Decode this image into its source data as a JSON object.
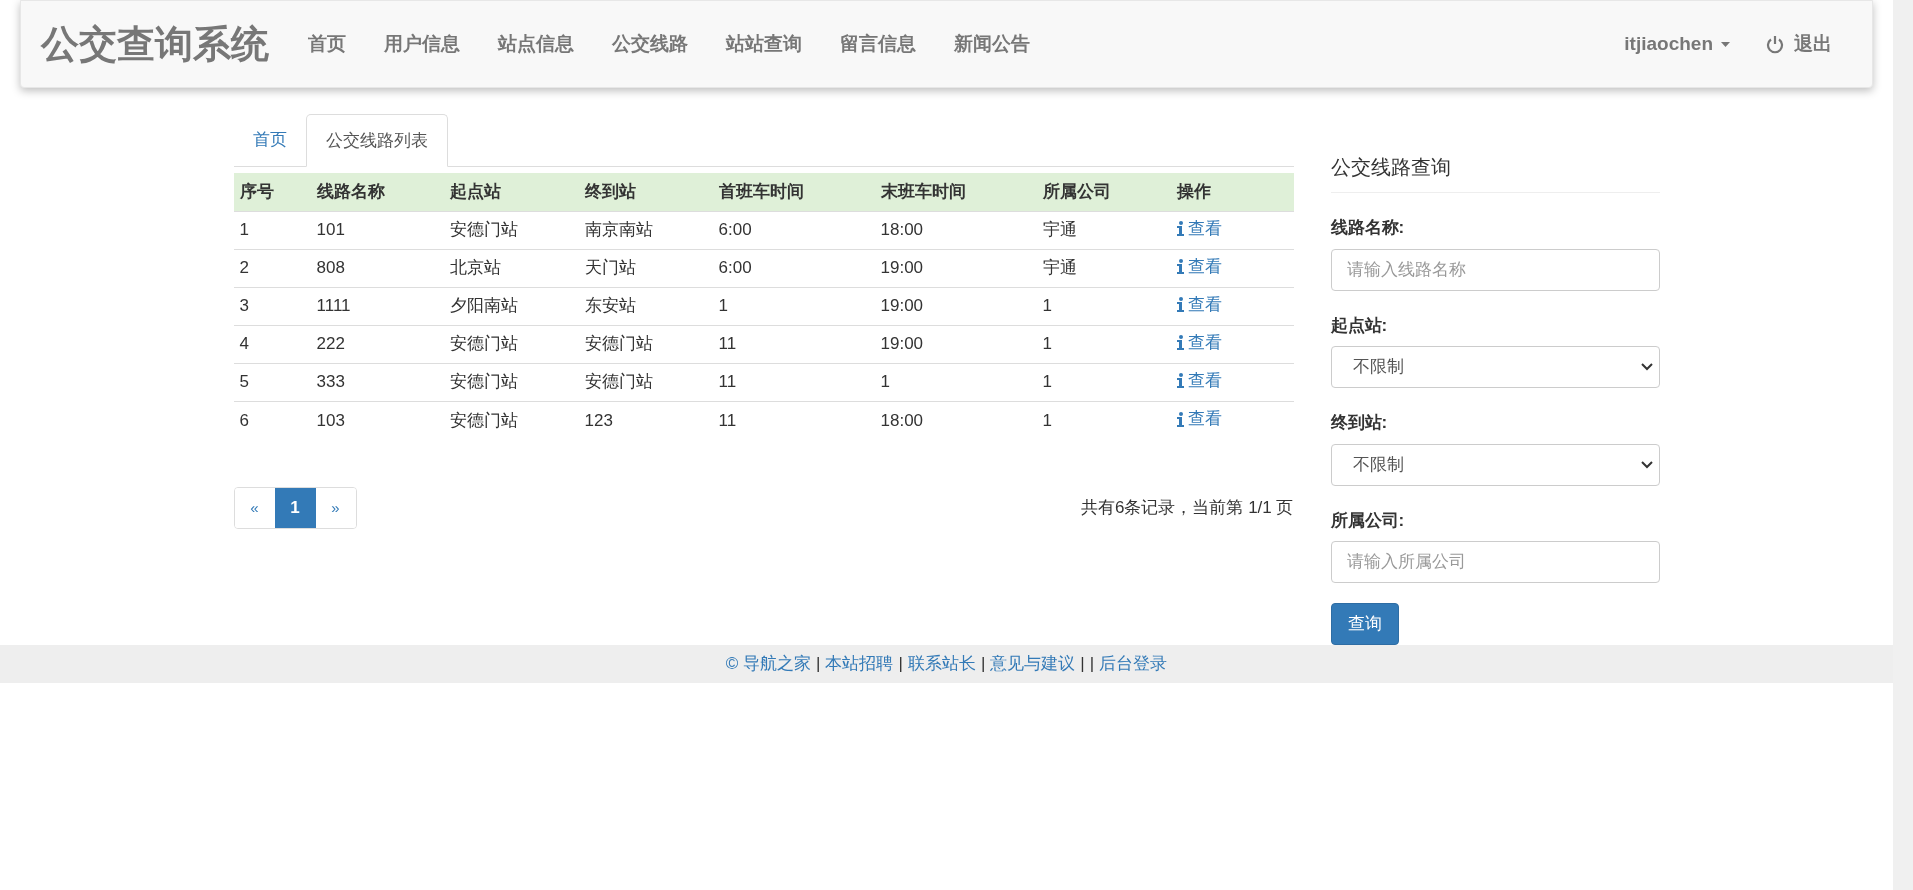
{
  "navbar": {
    "brand": "公交查询系统",
    "items": [
      "首页",
      "用户信息",
      "站点信息",
      "公交线路",
      "站站查询",
      "留言信息",
      "新闻公告"
    ],
    "user": "itjiaochen",
    "logout": "退出"
  },
  "tabs": [
    {
      "label": "首页",
      "selected": false
    },
    {
      "label": "公交线路列表",
      "selected": true
    }
  ],
  "table": {
    "columns": [
      "序号",
      "线路名称",
      "起点站",
      "终到站",
      "首班车时间",
      "末班车时间",
      "所属公司",
      "操作"
    ],
    "rows": [
      {
        "cells": [
          "1",
          "101",
          "安德门站",
          "南京南站",
          "6:00",
          "18:00",
          "宇通"
        ],
        "action": "查看"
      },
      {
        "cells": [
          "2",
          "808",
          "北京站",
          "天门站",
          "6:00",
          "19:00",
          "宇通"
        ],
        "action": "查看"
      },
      {
        "cells": [
          "3",
          "1111",
          "夕阳南站",
          "东安站",
          "1",
          "19:00",
          "1"
        ],
        "action": "查看"
      },
      {
        "cells": [
          "4",
          "222",
          "安德门站",
          "安德门站",
          "11",
          "19:00",
          "1"
        ],
        "action": "查看"
      },
      {
        "cells": [
          "5",
          "333",
          "安德门站",
          "安德门站",
          "11",
          "1",
          "1"
        ],
        "action": "查看"
      },
      {
        "cells": [
          "6",
          "103",
          "安德门站",
          "123",
          "11",
          "18:00",
          "1"
        ],
        "action": "查看"
      }
    ]
  },
  "pagination": {
    "pages": [
      {
        "label": "«",
        "selected": false
      },
      {
        "label": "1",
        "selected": true
      },
      {
        "label": "»",
        "selected": false
      }
    ],
    "summary": "共有6条记录，当前第 1/1 页"
  },
  "search_panel": {
    "title": "公交线路查询",
    "fields": [
      {
        "kind": "input",
        "label": "线路名称:",
        "placeholder": "请输入线路名称"
      },
      {
        "kind": "select",
        "label": "起点站:",
        "value": "不限制"
      },
      {
        "kind": "select",
        "label": "终到站:",
        "value": "不限制"
      },
      {
        "kind": "input",
        "label": "所属公司:",
        "placeholder": "请输入所属公司"
      }
    ],
    "button": "查询"
  },
  "footer": {
    "items": [
      {
        "kind": "link",
        "text": "© 导航之家"
      },
      {
        "kind": "separator",
        "text": "|"
      },
      {
        "kind": "link",
        "text": "本站招聘"
      },
      {
        "kind": "separator",
        "text": "|"
      },
      {
        "kind": "link",
        "text": "联系站长"
      },
      {
        "kind": "separator",
        "text": "|"
      },
      {
        "kind": "link",
        "text": "意见与建议"
      },
      {
        "kind": "separator",
        "text": "|"
      },
      {
        "kind": "separator",
        "text": "|"
      },
      {
        "kind": "link",
        "text": "后台登录"
      }
    ]
  }
}
